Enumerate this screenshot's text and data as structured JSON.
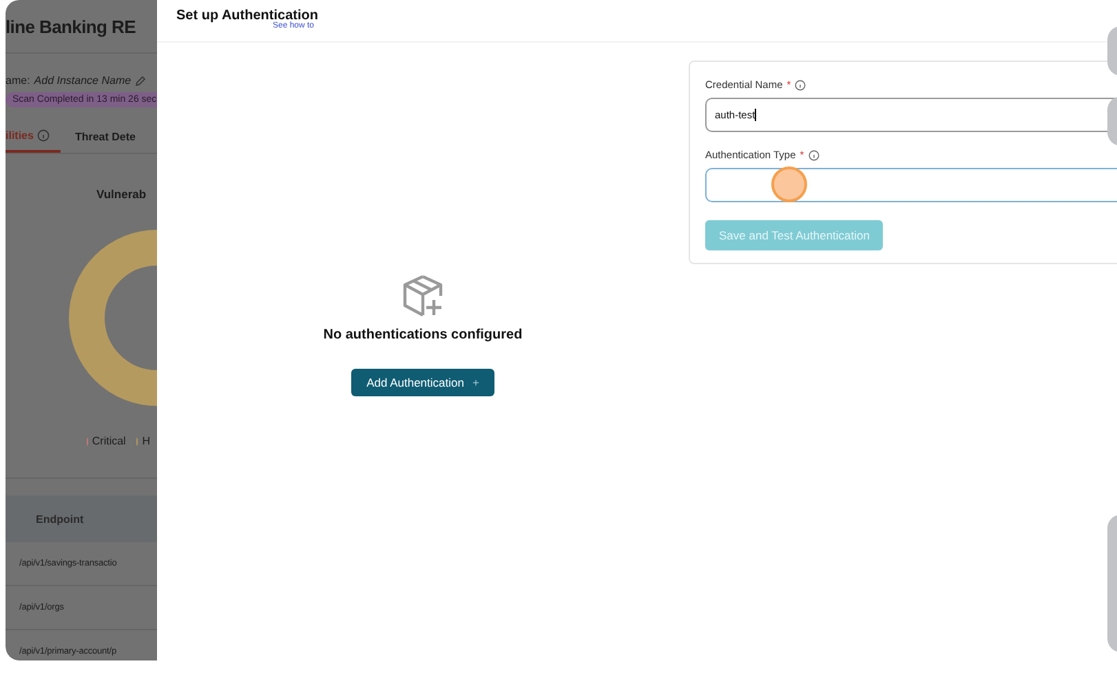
{
  "background_page": {
    "title": "line Banking RE",
    "instance_label": "ame:",
    "instance_name": "Add Instance Name",
    "scan_badge": "Scan Completed in 13 min 26 sec",
    "tabs": [
      {
        "label": "ilities",
        "selected": true
      },
      {
        "label": "Threat Dete",
        "selected": false
      }
    ],
    "chart_title": "Vulnerab",
    "legend": [
      {
        "label": "Critical",
        "color": "#c47878"
      },
      {
        "label": "H",
        "color": "#b59a5f"
      }
    ],
    "table": {
      "columns": [
        "Endpoint"
      ],
      "rows": [
        [
          "/api/v1/savings-transactio"
        ],
        [
          "/api/v1/orgs"
        ],
        [
          "/api/v1/primary-account/p"
        ]
      ]
    }
  },
  "drawer": {
    "title": "Set up Authentication",
    "help_link": "See how to",
    "empty_state": {
      "message": "No authentications configured",
      "button": "Add Authentication",
      "button_icon": "+"
    },
    "form": {
      "fields": [
        {
          "label": "Credential Name",
          "required_mark": "*",
          "value": "auth-test",
          "focused": false
        },
        {
          "label": "Authentication Type",
          "required_mark": "*",
          "focused": true
        }
      ],
      "submit": {
        "label": "Save and Test Authentication",
        "disabled": true
      }
    }
  }
}
